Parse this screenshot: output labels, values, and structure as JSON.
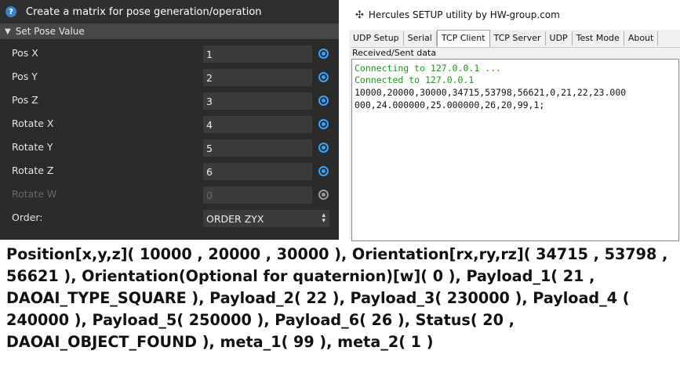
{
  "left_panel": {
    "title": "Create a matrix for pose generation/operation",
    "section": "Set Pose Value",
    "rows": [
      {
        "label": "Pos X",
        "value": "1"
      },
      {
        "label": "Pos Y",
        "value": "2"
      },
      {
        "label": "Pos Z",
        "value": "3"
      },
      {
        "label": "Rotate X",
        "value": "4"
      },
      {
        "label": "Rotate Y",
        "value": "5"
      },
      {
        "label": "Rotate Z",
        "value": "6"
      },
      {
        "label": "Rotate W",
        "value": "0"
      }
    ],
    "order_label": "Order:",
    "order_value": "ORDER ZYX"
  },
  "hercules": {
    "title": "Hercules SETUP utility by HW-group.com",
    "tabs": [
      "UDP Setup",
      "Serial",
      "TCP Client",
      "TCP Server",
      "UDP",
      "Test Mode",
      "About"
    ],
    "active_tab": "TCP Client",
    "group_label": "Received/Sent data",
    "lines": [
      "Connecting to 127.0.0.1 ...",
      "Connected to 127.0.0.1",
      "10000,20000,30000,34715,53798,56621,0,21,22,23.000",
      "000,24.000000,25.000000,26,20,99,1;"
    ]
  },
  "caption": {
    "text": "Position[x,y,z]( 10000 , 20000 , 30000 ), Orientation[rx,ry,rz]( 34715 , 53798 , 56621 ), Orientation(Optional for quaternion)[w]( 0 ), Payload_1( 21 , DAOAI_TYPE_SQUARE ), Payload_2( 22 ), Payload_3( 230000 ), Payload_4 ( 240000 ), Payload_5( 250000 ), Payload_6( 26 ), Status( 20 , DAOAI_OBJECT_FOUND ), meta_1( 99 ), meta_2( 1 )"
  },
  "colors": {
    "panel_bg": "#2b2b2b",
    "radio_accent": "#3aa2ff",
    "console_green": "#1a9a1a"
  }
}
